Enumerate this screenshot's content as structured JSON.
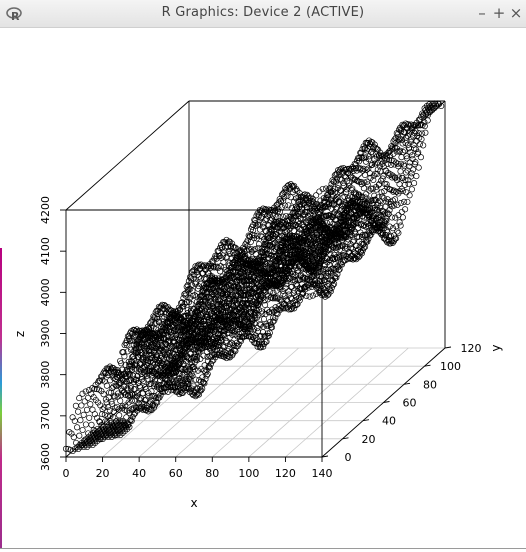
{
  "window": {
    "title": "R Graphics: Device 2 (ACTIVE)",
    "icons": {
      "app": "r-logo-icon",
      "minimize": "minimize-icon",
      "maximize": "maximize-icon",
      "close": "close-icon"
    }
  },
  "chart_data": {
    "type": "scatter",
    "projection": "3d",
    "description_free": true,
    "xlabel": "x",
    "ylabel": "y",
    "zlabel": "z",
    "xlim": [
      0,
      140
    ],
    "ylim": [
      0,
      120
    ],
    "zlim": [
      3600,
      4200
    ],
    "xticks": [
      "0",
      "20",
      "40",
      "60",
      "80",
      "100",
      "120",
      "140"
    ],
    "yticks": [
      "0",
      "20",
      "40",
      "60",
      "80",
      "100",
      "120"
    ],
    "zticks": [
      "3600",
      "3700",
      "3800",
      "3900",
      "4000",
      "4100",
      "4200"
    ],
    "grid": true,
    "marker": "open-circle",
    "color": "#000000"
  }
}
